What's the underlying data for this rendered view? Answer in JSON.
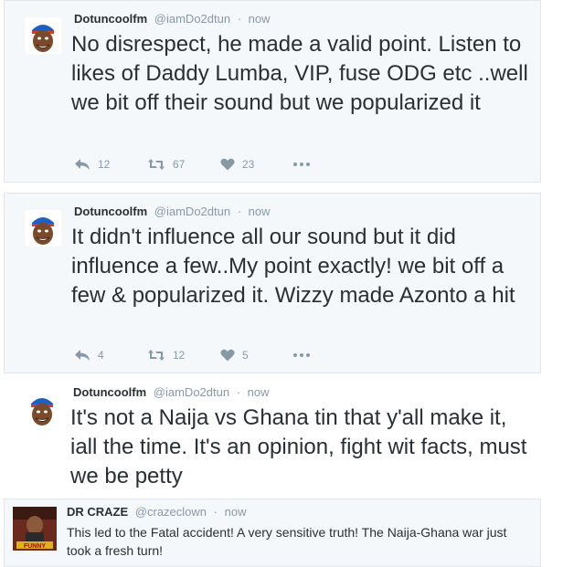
{
  "tweets": [
    {
      "name": "Dotuncoolfm",
      "handle": "@iamDo2dtun",
      "sep": "·",
      "time": "now",
      "text": "No disrespect, he made a valid point. Listen to likes of Daddy Lumba, VIP, fuse ODG etc ..well we bit off their sound but we popularized it",
      "replies": "12",
      "retweets": "67",
      "likes": "23"
    },
    {
      "name": "Dotuncoolfm",
      "handle": "@iamDo2dtun",
      "sep": "·",
      "time": "now",
      "text": "It didn't influence all our sound but it did influence a few..My point exactly! we bit off a few & popularized it. Wizzy made Azonto a hit",
      "replies": "4",
      "retweets": "12",
      "likes": "5"
    },
    {
      "name": "Dotuncoolfm",
      "handle": "@iamDo2dtun",
      "sep": "·",
      "time": "now",
      "text": "It's not a Naija vs Ghana tin that y'all make it, iall the time. It's an opinion, fight wit facts, must we be petty"
    },
    {
      "name": "DR CRAZE",
      "handle": "@crazeclown",
      "sep": "·",
      "time": "now",
      "text": "This led to the Fatal accident! A very sensitive truth! The Naija-Ghana war just took a fresh turn!",
      "avatar_text": "FUNNY"
    }
  ],
  "icons": {
    "reply": "reply-icon",
    "retweet": "retweet-icon",
    "like": "heart-icon",
    "more": "more-icon"
  },
  "colors": {
    "icon_gray": "#8899a6",
    "text": "#292f33",
    "card_bg": "#f5f8fa",
    "border": "#e1e8ed"
  }
}
